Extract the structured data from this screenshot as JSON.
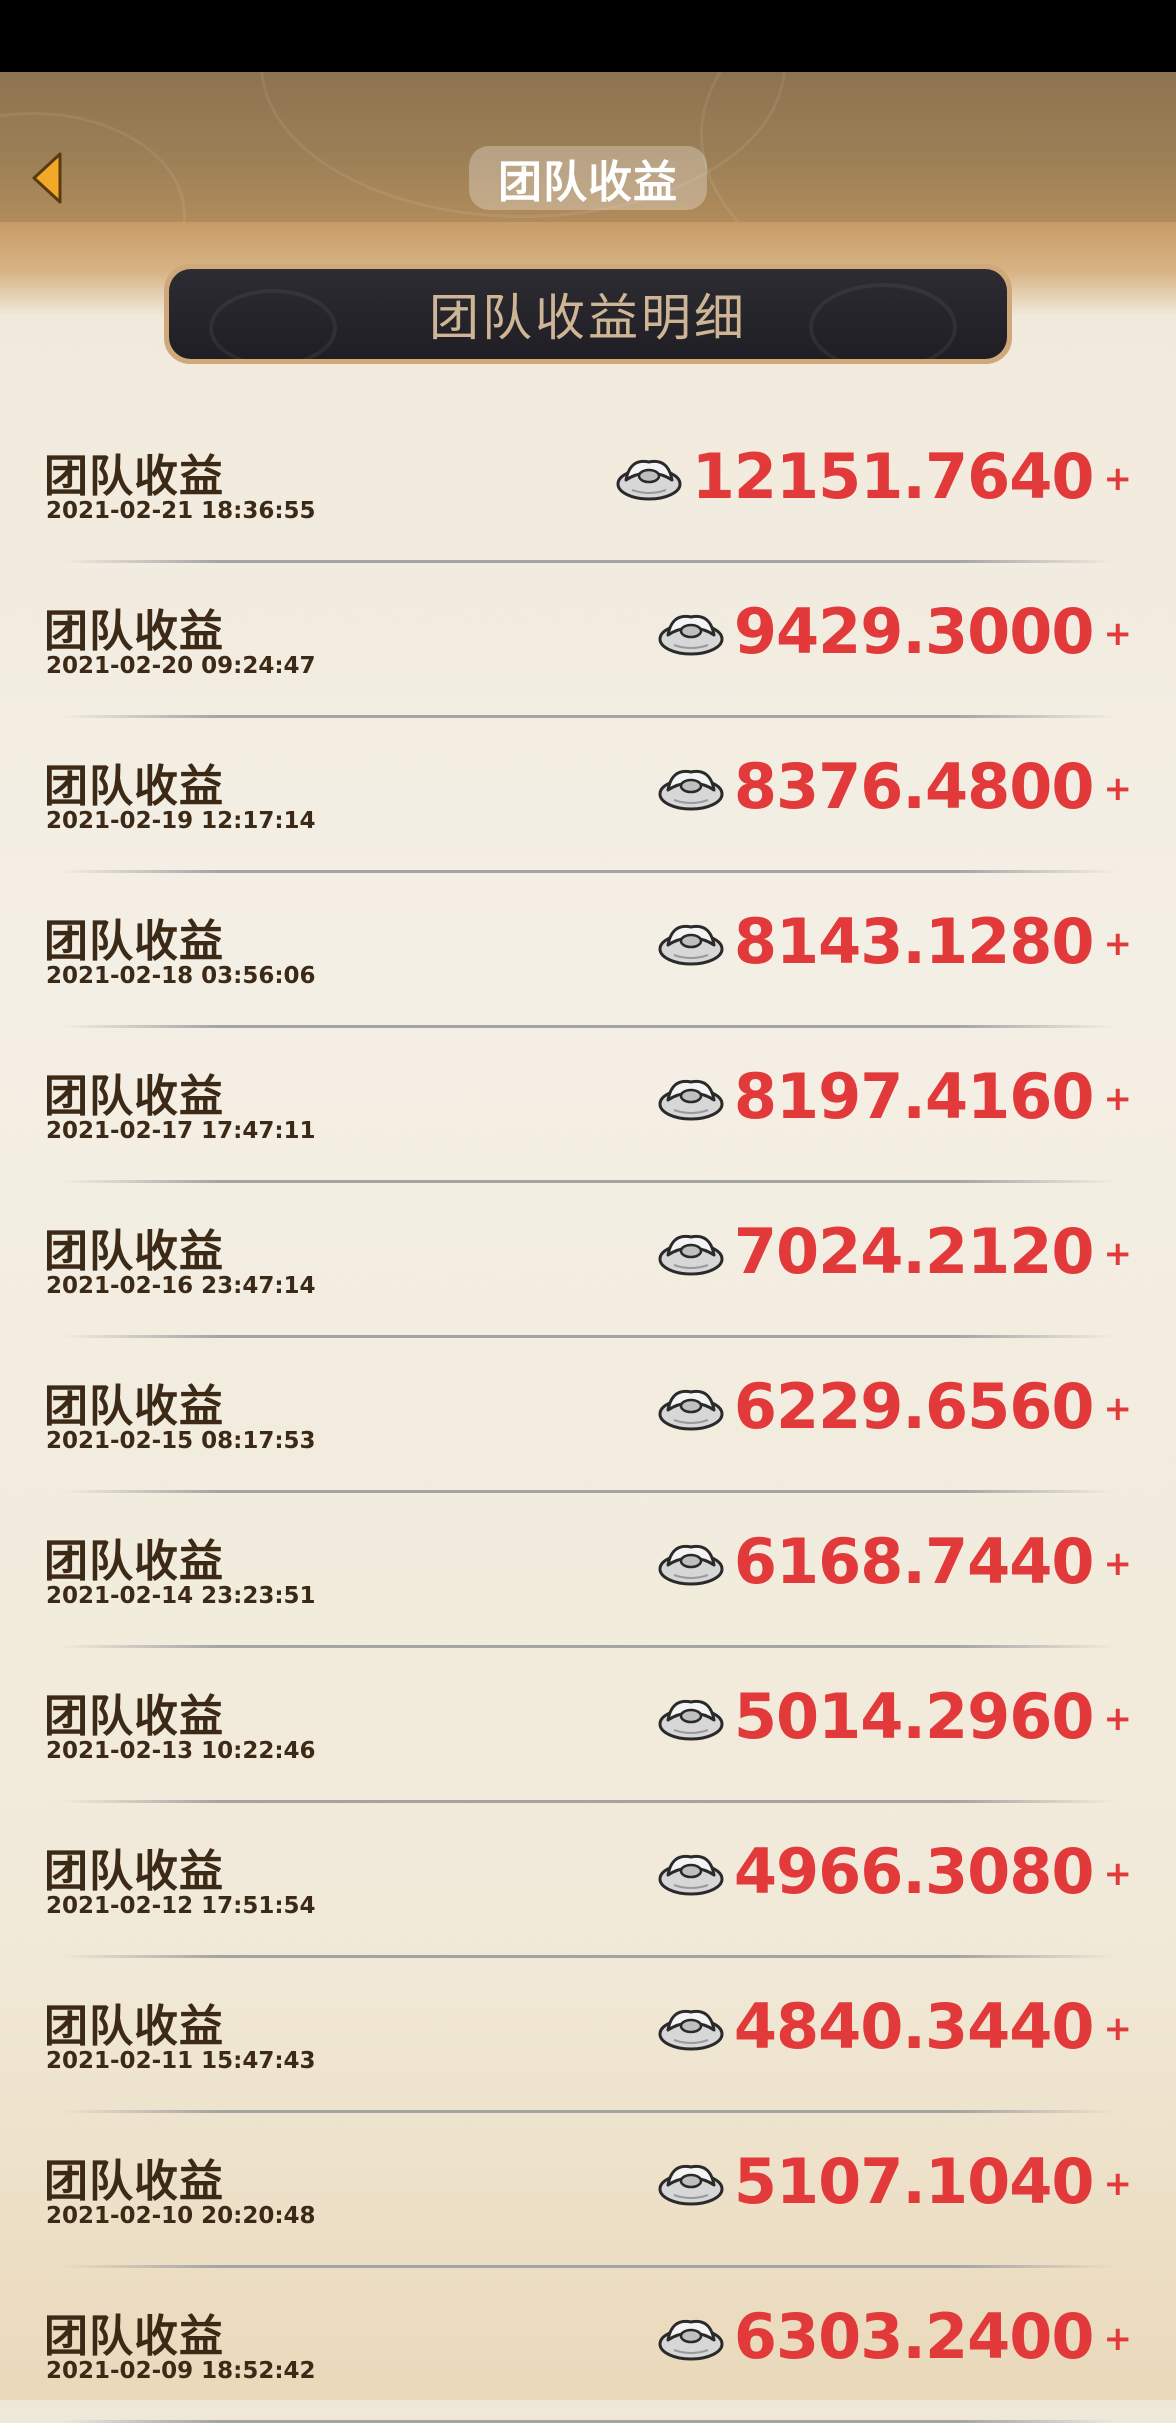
{
  "header": {
    "title": "团队收益"
  },
  "section": {
    "title": "团队收益明细"
  },
  "colors": {
    "amount": "#e23a3a",
    "label": "#3c2a17",
    "header_bg": "#8d7350",
    "banner_bg": "#24232a"
  },
  "icons": {
    "back": "back-arrow-icon",
    "currency": "silver-ingot-icon"
  },
  "records": [
    {
      "label": "团队收益",
      "time": "2021-02-21 18:36:55",
      "amount": "12151.7640",
      "sign": "+"
    },
    {
      "label": "团队收益",
      "time": "2021-02-20 09:24:47",
      "amount": "9429.3000",
      "sign": "+"
    },
    {
      "label": "团队收益",
      "time": "2021-02-19 12:17:14",
      "amount": "8376.4800",
      "sign": "+"
    },
    {
      "label": "团队收益",
      "time": "2021-02-18 03:56:06",
      "amount": "8143.1280",
      "sign": "+"
    },
    {
      "label": "团队收益",
      "time": "2021-02-17 17:47:11",
      "amount": "8197.4160",
      "sign": "+"
    },
    {
      "label": "团队收益",
      "time": "2021-02-16 23:47:14",
      "amount": "7024.2120",
      "sign": "+"
    },
    {
      "label": "团队收益",
      "time": "2021-02-15 08:17:53",
      "amount": "6229.6560",
      "sign": "+"
    },
    {
      "label": "团队收益",
      "time": "2021-02-14 23:23:51",
      "amount": "6168.7440",
      "sign": "+"
    },
    {
      "label": "团队收益",
      "time": "2021-02-13 10:22:46",
      "amount": "5014.2960",
      "sign": "+"
    },
    {
      "label": "团队收益",
      "time": "2021-02-12 17:51:54",
      "amount": "4966.3080",
      "sign": "+"
    },
    {
      "label": "团队收益",
      "time": "2021-02-11 15:47:43",
      "amount": "4840.3440",
      "sign": "+"
    },
    {
      "label": "团队收益",
      "time": "2021-02-10 20:20:48",
      "amount": "5107.1040",
      "sign": "+"
    },
    {
      "label": "团队收益",
      "time": "2021-02-09 18:52:42",
      "amount": "6303.2400",
      "sign": "+"
    }
  ]
}
